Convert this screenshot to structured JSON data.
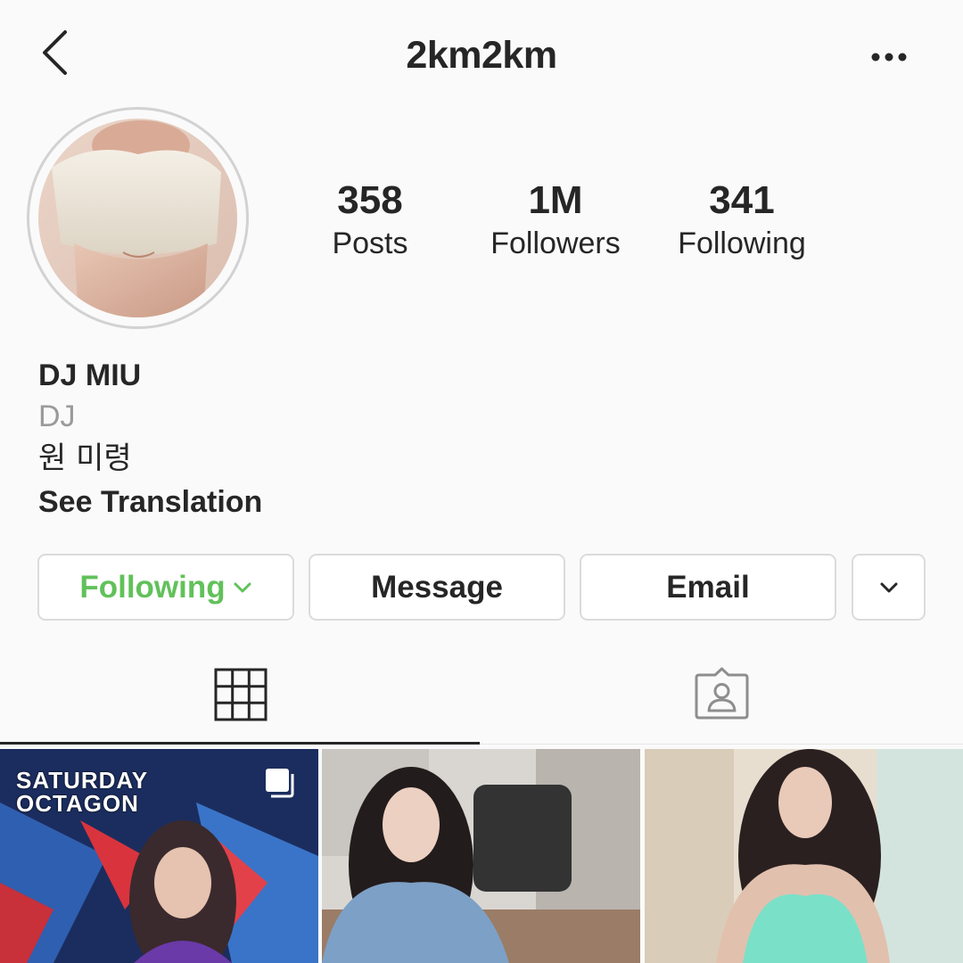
{
  "header": {
    "username": "2km2km"
  },
  "stats": {
    "posts": {
      "value": "358",
      "label": "Posts"
    },
    "followers": {
      "value": "1M",
      "label": "Followers"
    },
    "following": {
      "value": "341",
      "label": "Following"
    }
  },
  "bio": {
    "name": "DJ MIU",
    "category": "DJ",
    "text": "원 미령",
    "translate_label": "See Translation"
  },
  "actions": {
    "following_label": "Following",
    "message_label": "Message",
    "email_label": "Email"
  },
  "tabs": [
    {
      "name": "posts-grid",
      "icon": "grid-icon",
      "active": true
    },
    {
      "name": "tagged",
      "icon": "tagged-user-icon",
      "active": false
    }
  ],
  "posts": [
    {
      "overlay_text": "SATURDAY OCTAGON",
      "multi_photo": true
    },
    {
      "overlay_text": "",
      "multi_photo": false
    },
    {
      "overlay_text": "",
      "multi_photo": false
    }
  ],
  "colors": {
    "following_accent": "#61c15a",
    "text": "#262626",
    "secondary_text": "#9a9a9a",
    "border": "#dbdbdb",
    "background": "#fafafa"
  }
}
